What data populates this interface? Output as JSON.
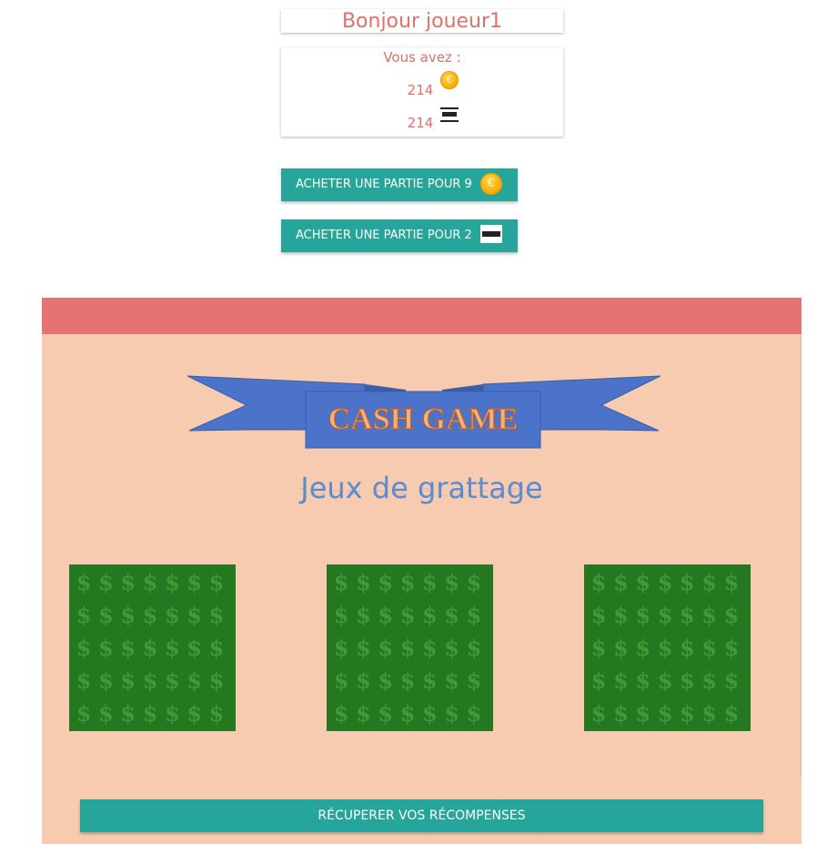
{
  "header": {
    "greeting": "Bonjour joueur1"
  },
  "wallet": {
    "label": "Vous avez :",
    "coins": "214",
    "coins_icon": "coin-icon",
    "tickets": "214",
    "tickets_icon": "ticket-icon"
  },
  "actions": {
    "buy_coins_label": "ACHETER UNE PARTIE POUR 9",
    "buy_tickets_label": "ACHETER UNE PARTIE POUR 2"
  },
  "game": {
    "logo_text": "CASH GAME",
    "subtitle": "Jeux de grattage",
    "cards": [
      {
        "id": 1
      },
      {
        "id": 2
      },
      {
        "id": 3
      }
    ],
    "card_symbol": "$",
    "reward_label": "RÉCUPERER VOS RÉCOMPENSES"
  },
  "colors": {
    "accent": "#26a69a",
    "header_bar": "#e57373",
    "game_bg": "#f6cbaf",
    "scratch": "#24781f",
    "text_salmon": "#e0706a",
    "banner_blue": "#4a73c9"
  }
}
